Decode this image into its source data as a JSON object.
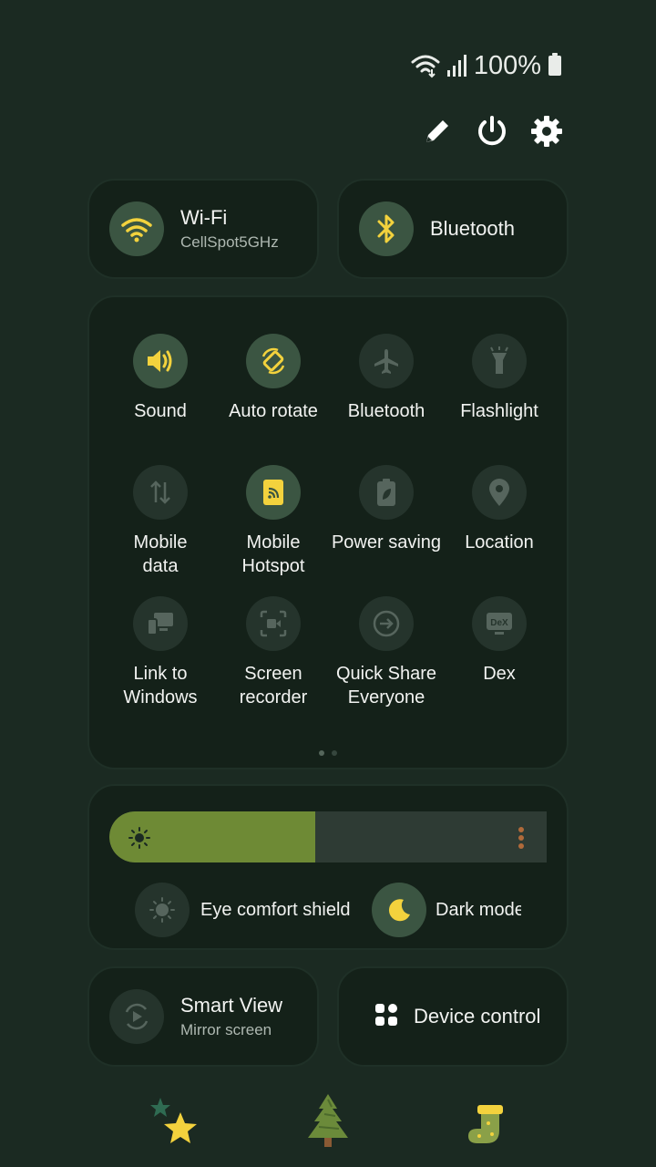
{
  "status_bar": {
    "battery_percent": "100%"
  },
  "header": {
    "edit_icon": "pencil-icon",
    "power_icon": "power-icon",
    "settings_icon": "gear-icon"
  },
  "wifi_tile": {
    "title": "Wi-Fi",
    "subtitle": "CellSpot5GHz",
    "state": "on"
  },
  "bluetooth_tile": {
    "title": "Bluetooth",
    "state": "on"
  },
  "quick_toggles": [
    {
      "label": "Sound",
      "icon": "speaker-icon",
      "state": "on"
    },
    {
      "label": "Auto rotate",
      "icon": "rotate-icon",
      "state": "on"
    },
    {
      "label": "Bluetooth",
      "icon": "airplane-icon",
      "state": "off"
    },
    {
      "label": "Flashlight",
      "icon": "flashlight-icon",
      "state": "off"
    },
    {
      "label": "Mobile\ndata",
      "icon": "mobile-data-icon",
      "state": "off"
    },
    {
      "label": "Mobile\nHotspot",
      "icon": "hotspot-icon",
      "state": "on"
    },
    {
      "label": "Power saving",
      "icon": "battery-leaf-icon",
      "state": "off"
    },
    {
      "label": "Location",
      "icon": "location-pin-icon",
      "state": "off"
    },
    {
      "label": "Link to\nWindows",
      "icon": "link-windows-icon",
      "state": "off"
    },
    {
      "label": "Screen\nrecorder",
      "icon": "screen-recorder-icon",
      "state": "off"
    },
    {
      "label": "Quick Share\nEveryone",
      "icon": "quick-share-icon",
      "state": "off"
    },
    {
      "label": "Dex",
      "icon": "dex-icon",
      "state": "off"
    }
  ],
  "page_indicator": {
    "pages": 2,
    "current": 1
  },
  "brightness": {
    "level": 0.47
  },
  "display_toggles": {
    "eye_comfort": {
      "label": "Eye comfort shield",
      "state": "off"
    },
    "dark_mode": {
      "label": "Dark mode",
      "state": "on"
    }
  },
  "smart_view": {
    "title": "Smart View",
    "subtitle": "Mirror screen"
  },
  "device_control": {
    "title": "Device control"
  },
  "colors": {
    "accent_yellow": "#f3d23d",
    "tile_on": "#3b5542",
    "tile_off": "#25342c",
    "brightness_fill": "#6e8a35"
  }
}
